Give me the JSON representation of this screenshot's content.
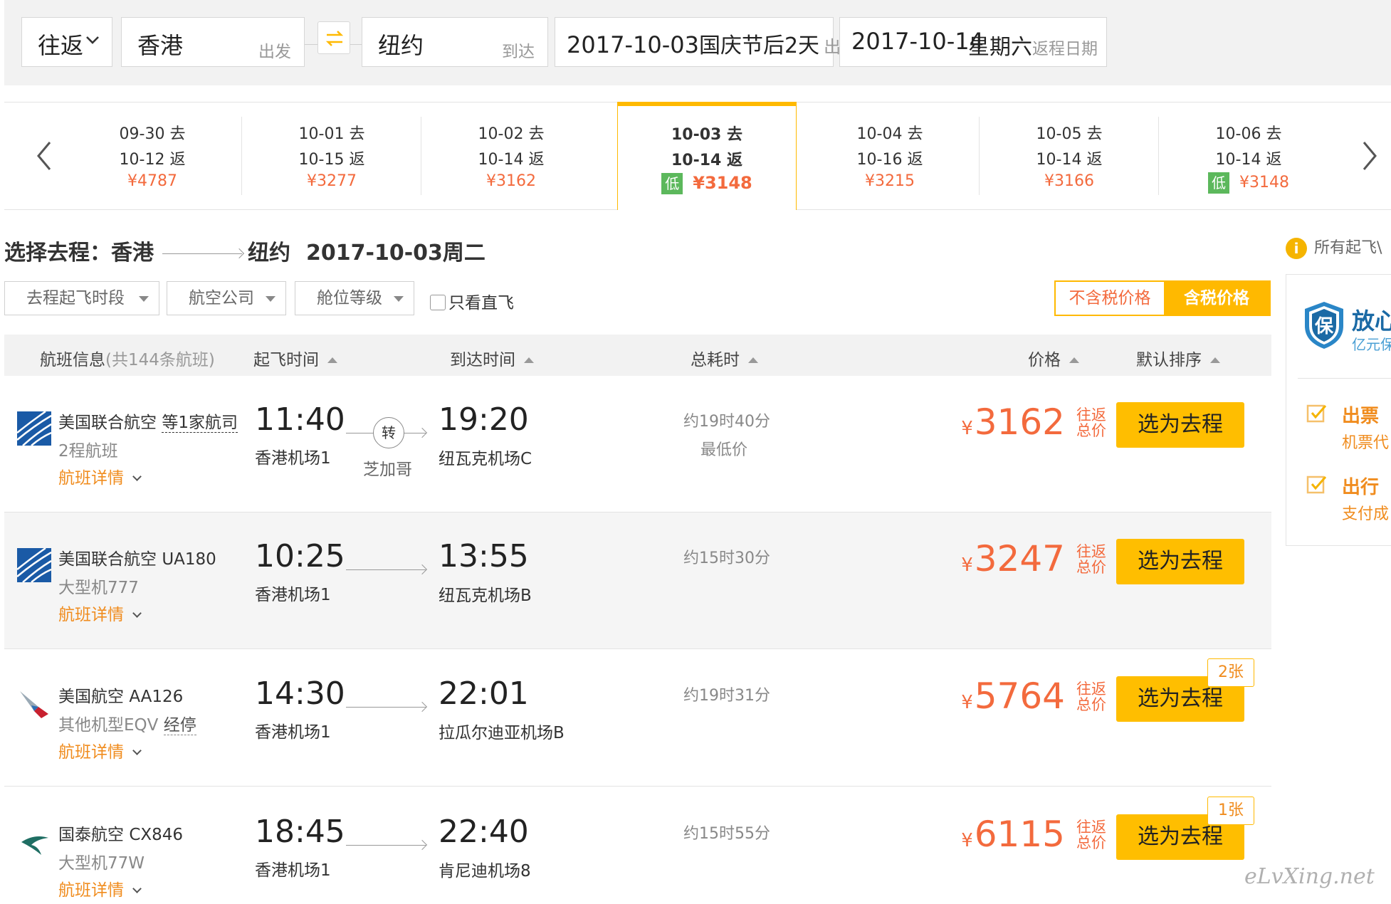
{
  "search": {
    "trip_type": "往返",
    "from_city": "香港",
    "from_label": "出发",
    "to_city": "纽约",
    "to_label": "到达",
    "depart_date": "2017-10-03",
    "depart_note": "国庆节后2天",
    "depart_label": "出发日期",
    "return_date": "2017-10-14",
    "return_weekday": "星期六",
    "return_label": "返程日期"
  },
  "date_strip": [
    {
      "go": "09-30 去",
      "back": "10-12 返",
      "price": "¥4787",
      "low": false
    },
    {
      "go": "10-01 去",
      "back": "10-15 返",
      "price": "¥3277",
      "low": false
    },
    {
      "go": "10-02 去",
      "back": "10-14 返",
      "price": "¥3162",
      "low": false
    },
    {
      "go": "10-03 去",
      "back": "10-14 返",
      "price": "¥3148",
      "low": true,
      "active": true
    },
    {
      "go": "10-04 去",
      "back": "10-16 返",
      "price": "¥3215",
      "low": false
    },
    {
      "go": "10-05 去",
      "back": "10-14 返",
      "price": "¥3166",
      "low": false
    },
    {
      "go": "10-06 去",
      "back": "10-14 返",
      "price": "¥3148",
      "low": true
    }
  ],
  "low_badge": "低",
  "title": {
    "prefix": "选择去程：",
    "from": "香港",
    "to": "纽约",
    "date": "2017-10-03周二"
  },
  "notice": "所有起飞\\",
  "filters": {
    "depart_time": "去程起飞时段",
    "airline": "航空公司",
    "cabin": "舱位等级",
    "direct_only": "只看直飞"
  },
  "price_toggle": {
    "excl_tax": "不含税价格",
    "incl_tax": "含税价格"
  },
  "table_header": {
    "flight_info": "航班信息",
    "flight_count": "(共144条航班)",
    "depart_time": "起飞时间",
    "arrive_time": "到达时间",
    "duration": "总耗时",
    "price": "价格",
    "default_sort": "默认排序"
  },
  "flights": [
    {
      "airline": "美国联合航空",
      "flight_no": "等1家航司",
      "aircraft": "2程航班",
      "detail": "航班详情",
      "depart_time": "11:40",
      "depart_airport": "香港机场1",
      "arrive_time": "19:20",
      "arrive_airport": "纽瓦克机场C",
      "transfer": "转",
      "transfer_city": "芝加哥",
      "duration": "约19时40分",
      "lowest_tag": "最低价",
      "price_symbol": "¥",
      "price": "3162",
      "price_note": "往返总价",
      "select_label": "选为去程"
    },
    {
      "airline": "美国联合航空",
      "flight_no": "UA180",
      "aircraft": "大型机777",
      "detail": "航班详情",
      "depart_time": "10:25",
      "depart_airport": "香港机场1",
      "arrive_time": "13:55",
      "arrive_airport": "纽瓦克机场B",
      "duration": "约15时30分",
      "price_symbol": "¥",
      "price": "3247",
      "price_note": "往返总价",
      "select_label": "选为去程"
    },
    {
      "airline": "美国航空",
      "flight_no": "AA126",
      "aircraft": "其他机型EQV",
      "stop": "经停",
      "detail": "航班详情",
      "depart_time": "14:30",
      "depart_airport": "香港机场1",
      "arrive_time": "22:01",
      "arrive_airport": "拉瓜尔迪亚机场B",
      "duration": "约19时31分",
      "price_symbol": "¥",
      "price": "5764",
      "price_note": "往返总价",
      "select_label": "选为去程",
      "tickets_left": "2张"
    },
    {
      "airline": "国泰航空",
      "flight_no": "CX846",
      "aircraft": "大型机77W",
      "detail": "航班详情",
      "depart_time": "18:45",
      "depart_airport": "香港机场1",
      "arrive_time": "22:40",
      "arrive_airport": "肯尼迪机场8",
      "duration": "约15时55分",
      "price_symbol": "¥",
      "price": "6115",
      "price_note": "往返总价",
      "select_label": "选为去程",
      "tickets_left": "1张"
    }
  ],
  "promo": {
    "badge": "保",
    "headline": "放心",
    "subline": "亿元保",
    "item1_title": "出票",
    "item1_sub": "机票代",
    "item2_title": "出行",
    "item2_sub": "支付成"
  },
  "watermark": "eLvXing.net",
  "colors": {
    "accent": "#ffbe00",
    "price": "#f36a3d",
    "link": "#f08c1e",
    "low_badge": "#5cb85c"
  },
  "icons": {
    "swap": "swap-arrows-icon",
    "prev": "chevron-left-icon",
    "next": "chevron-right-icon",
    "dropdown": "chevron-down-icon",
    "info": "info-icon",
    "united": "united-globe-logo-icon",
    "american": "american-eagle-logo-icon",
    "cathay": "cathay-brushwing-logo-icon",
    "shield": "shield-icon",
    "check": "checkbox-check-icon"
  }
}
